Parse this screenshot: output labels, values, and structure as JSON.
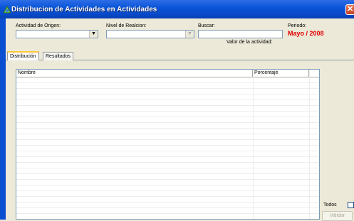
{
  "window": {
    "title": "Distribucion de Actividades en Actividades"
  },
  "filters": {
    "actividad_origen_label": "Actividad de Origen:",
    "nivel_relacion_label": "Nivel de Realcion:",
    "buscar_label": "Buscar:",
    "periodo_label": "Periodo:",
    "periodo_value": "Mayo / 2008",
    "valor_actividad_label": "Valor de la actividad:"
  },
  "tabs": [
    {
      "label": "Distribución",
      "active": true
    },
    {
      "label": "Resultados",
      "active": false
    }
  ],
  "grid": {
    "columns": [
      "Nombre",
      "Porcentaje",
      ""
    ],
    "rows": []
  },
  "todos_label": "Todos",
  "validar_label": "Validar",
  "colors": {
    "periodo": "#E00000",
    "titlebar": "#0A55D9"
  }
}
